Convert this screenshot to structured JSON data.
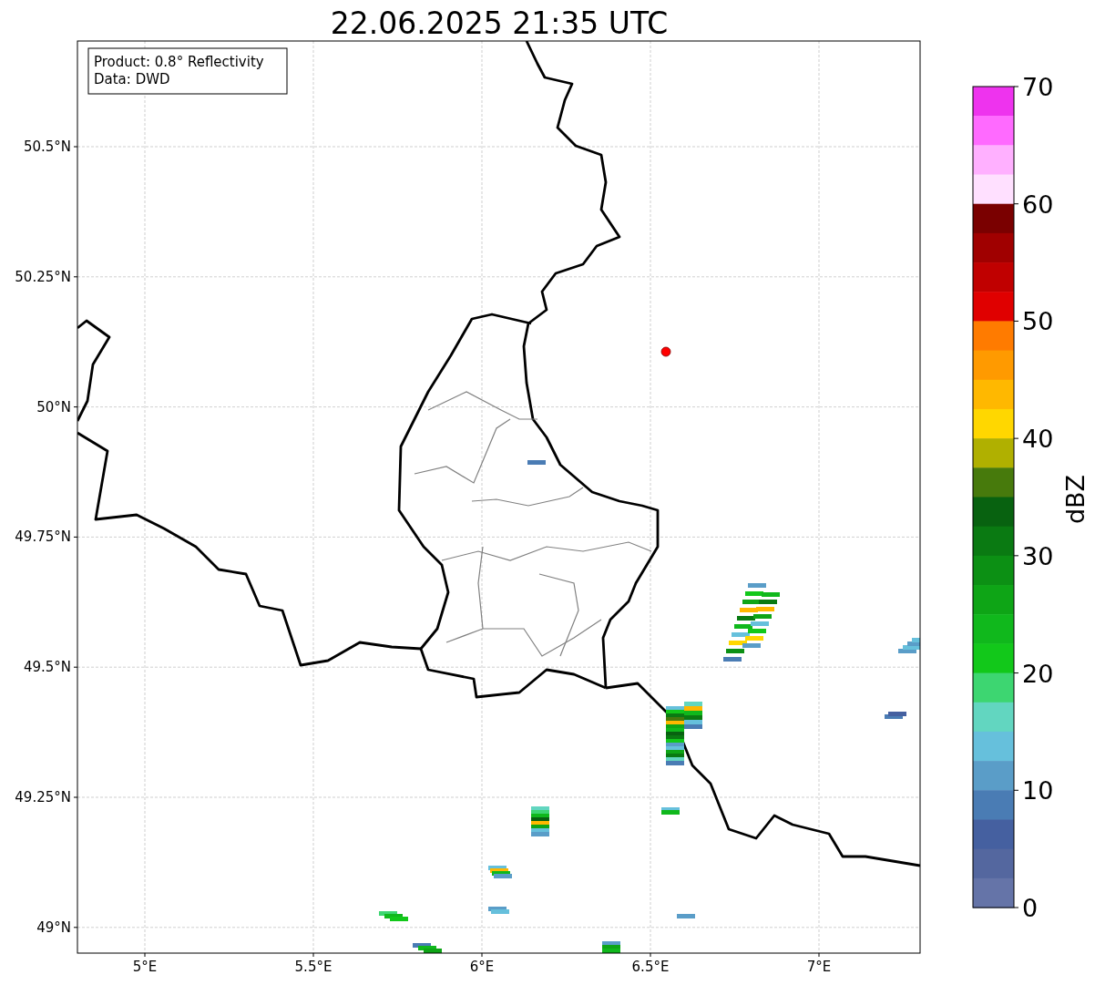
{
  "title": "22.06.2025 21:35 UTC",
  "info_box": {
    "lines": [
      "Product: 0.8° Reflectivity",
      "Data: DWD"
    ]
  },
  "map": {
    "lat_ticks": [
      "50.5°N",
      "50.25°N",
      "50°N",
      "49.75°N",
      "49.5°N",
      "49.25°N",
      "49°N"
    ],
    "lon_ticks": [
      "5°E",
      "5.5°E",
      "6°E",
      "6.5°E",
      "7°E"
    ]
  },
  "colorbar": {
    "label": "dBZ",
    "ticks": [
      "70",
      "60",
      "50",
      "40",
      "30",
      "20",
      "10",
      "0"
    ],
    "bands": [
      {
        "color": "#ee33ee"
      },
      {
        "color": "#ff6aff"
      },
      {
        "color": "#ffb0ff"
      },
      {
        "color": "#ffe0ff"
      },
      {
        "color": "#7a0000"
      },
      {
        "color": "#a00000"
      },
      {
        "color": "#c00000"
      },
      {
        "color": "#e00000"
      },
      {
        "color": "#ff7b00"
      },
      {
        "color": "#ff9a00"
      },
      {
        "color": "#ffb800"
      },
      {
        "color": "#ffd700"
      },
      {
        "color": "#b0b000"
      },
      {
        "color": "#477a0c"
      },
      {
        "color": "#086210"
      },
      {
        "color": "#0a7a12"
      },
      {
        "color": "#0c9014"
      },
      {
        "color": "#0ea516"
      },
      {
        "color": "#10b81c"
      },
      {
        "color": "#12c81a"
      },
      {
        "color": "#3dd671"
      },
      {
        "color": "#62d6c0"
      },
      {
        "color": "#66c0dc"
      },
      {
        "color": "#5a9dc8"
      },
      {
        "color": "#4a7cb4"
      },
      {
        "color": "#4560a0"
      },
      {
        "color": "#54679f"
      },
      {
        "color": "#6574a8"
      }
    ]
  }
}
